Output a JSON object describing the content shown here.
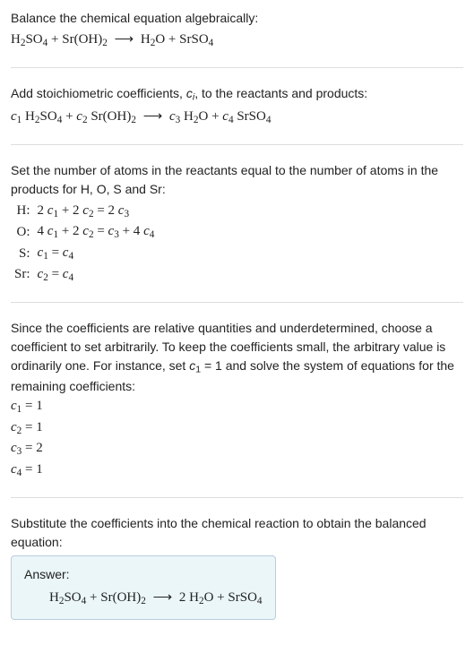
{
  "s1": {
    "text": "Balance the chemical equation algebraically:"
  },
  "s2": {
    "text_a": "Add stoichiometric coefficients, ",
    "ci": "c",
    "ci_sub": "i",
    "text_b": ", to the reactants and products:"
  },
  "s3": {
    "text": "Set the number of atoms in the reactants equal to the number of atoms in the products for H, O, S and Sr:",
    "rows": [
      {
        "el": "H:",
        "eq": "2 c₁ + 2 c₂ = 2 c₃"
      },
      {
        "el": "O:",
        "eq": "4 c₁ + 2 c₂ = c₃ + 4 c₄"
      },
      {
        "el": "S:",
        "eq": "c₁ = c₄"
      },
      {
        "el": "Sr:",
        "eq": "c₂ = c₄"
      }
    ]
  },
  "s4": {
    "text_a": "Since the coefficients are relative quantities and underdetermined, choose a coefficient to set arbitrarily. To keep the coefficients small, the arbitrary value is ordinarily one. For instance, set ",
    "c1": "c₁ = 1",
    "text_b": " and solve the system of equations for the remaining coefficients:",
    "coefs": [
      "c₁ = 1",
      "c₂ = 1",
      "c₃ = 2",
      "c₄ = 1"
    ]
  },
  "s5": {
    "text": "Substitute the coefficients into the chemical reaction to obtain the balanced equation:"
  },
  "answer": {
    "label": "Answer:"
  },
  "chem": {
    "H2SO4": "H₂SO4",
    "SrOH2": "Sr(OH)₂",
    "H2O": "H₂O",
    "SrSO4": "SrSO₄",
    "arrow": "⟶",
    "plus": " + ",
    "two": "2 "
  }
}
